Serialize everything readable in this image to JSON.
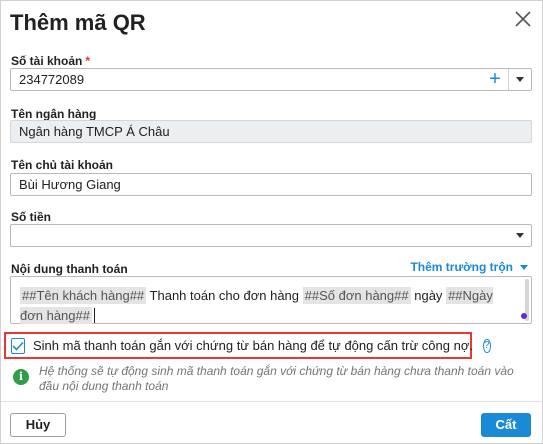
{
  "dialog": {
    "title": "Thêm mã QR",
    "close_icon": "close-icon"
  },
  "fields": {
    "account_number": {
      "label": "Số tài khoản",
      "required_mark": "*",
      "value": "234772089",
      "add_icon": "plus-icon",
      "dropdown_icon": "chevron-down-icon"
    },
    "bank_name": {
      "label": "Tên ngân hàng",
      "value": "Ngân hàng TMCP Á Châu"
    },
    "account_holder": {
      "label": "Tên chủ tài khoản",
      "value": "Bùi Hương Giang"
    },
    "amount": {
      "label": "Số tiền",
      "value": "",
      "dropdown_icon": "chevron-down-icon"
    },
    "payment_content": {
      "label": "Nội dung thanh toán",
      "merge_fields_link": "Thêm trường trộn",
      "tags": [
        "##Tên khách hàng##",
        "##Số đơn hàng##",
        "##Ngày đơn hàng##"
      ],
      "texts": [
        "Thanh toán cho đơn hàng",
        "ngày"
      ]
    }
  },
  "option": {
    "checked": true,
    "label": "Sinh mã thanh toán gắn với chứng từ bán hàng để tự động cấn trừ công nợ.",
    "help_icon": "help-icon",
    "help_glyph": "?"
  },
  "info": {
    "icon": "info-icon",
    "glyph": "i",
    "text": "Hệ thống sẽ tự động sinh mã thanh toán gắn với chứng từ bán hàng chưa thanh toán vào đầu nội dung thanh toán"
  },
  "footer": {
    "cancel_label": "Hủy",
    "save_label": "Cất"
  },
  "colors": {
    "primary": "#1b8ad6",
    "highlight_border": "#e53935",
    "info_green": "#2e9e48"
  }
}
